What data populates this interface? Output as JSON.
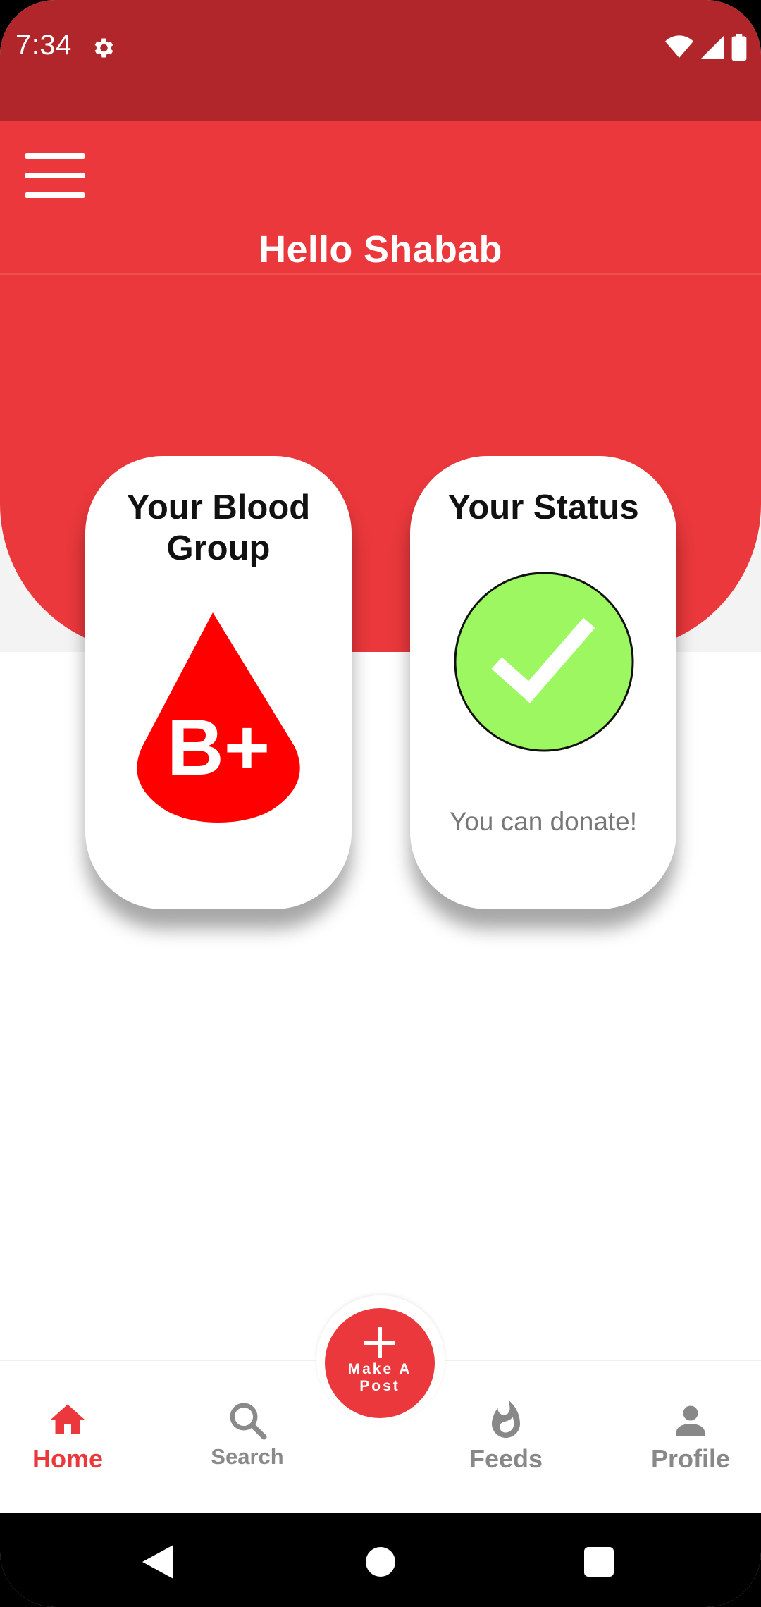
{
  "status_bar": {
    "time": "7:34",
    "icons": [
      "settings-gear-icon",
      "wifi-icon",
      "cell-signal-icon",
      "battery-icon"
    ]
  },
  "header": {
    "greeting": "Hello Shabab",
    "menu_icon": "hamburger-menu-icon"
  },
  "cards": {
    "blood_group": {
      "title": "Your Blood Group",
      "value": "B+"
    },
    "status": {
      "title": "Your Status",
      "message": "You can donate!",
      "icon": "checkmark-icon"
    }
  },
  "fab": {
    "label": "Make A Post",
    "icon": "plus-icon"
  },
  "bottom_nav": {
    "items": [
      {
        "label": "Home",
        "icon": "home-icon",
        "active": true
      },
      {
        "label": "Search",
        "icon": "search-icon",
        "active": false
      },
      {
        "label": "Feeds",
        "icon": "fire-icon",
        "active": false
      },
      {
        "label": "Profile",
        "icon": "person-icon",
        "active": false
      }
    ]
  },
  "colors": {
    "status_bar": "#B0262B",
    "primary": "#EA383C",
    "status_ok": "#9CF761",
    "blood_red": "#FF0000"
  }
}
